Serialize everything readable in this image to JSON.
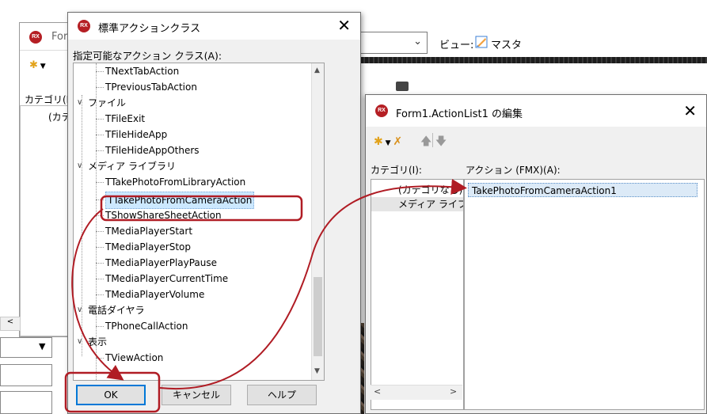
{
  "ide": {
    "view_label": "ビュー:",
    "view_value": "マスタ",
    "back_form_title": "Form",
    "back_category_label": "カテゴリ(I)",
    "back_category_item": "(カテ"
  },
  "std_dialog": {
    "title": "標準アクションクラス",
    "list_label": "指定可能なアクション クラス(A):",
    "tree": [
      {
        "label": "TNextTabAction",
        "level": 2
      },
      {
        "label": "TPreviousTabAction",
        "level": 2
      },
      {
        "label": "ファイル",
        "level": 1
      },
      {
        "label": "TFileExit",
        "level": 2
      },
      {
        "label": "TFileHideApp",
        "level": 2
      },
      {
        "label": "TFileHideAppOthers",
        "level": 2
      },
      {
        "label": "メディア ライブラリ",
        "level": 1
      },
      {
        "label": "TTakePhotoFromLibraryAction",
        "level": 2
      },
      {
        "label": "TTakePhotoFromCameraAction",
        "level": 2,
        "selected": true
      },
      {
        "label": "TShowShareSheetAction",
        "level": 2
      },
      {
        "label": "TMediaPlayerStart",
        "level": 2
      },
      {
        "label": "TMediaPlayerStop",
        "level": 2
      },
      {
        "label": "TMediaPlayerPlayPause",
        "level": 2
      },
      {
        "label": "TMediaPlayerCurrentTime",
        "level": 2
      },
      {
        "label": "TMediaPlayerVolume",
        "level": 2
      },
      {
        "label": "電話ダイヤラ",
        "level": 1
      },
      {
        "label": "TPhoneCallAction",
        "level": 2
      },
      {
        "label": "表示",
        "level": 1
      },
      {
        "label": "TViewAction",
        "level": 2
      }
    ],
    "ok_label": "OK",
    "cancel_label": "キャンセル",
    "help_label": "ヘルプ"
  },
  "action_list": {
    "title": "Form1.ActionList1 の編集",
    "category_label": "カテゴリ(I):",
    "action_label": "アクション (FMX)(A):",
    "categories": [
      {
        "label": "(カテゴリなし)",
        "selected": false
      },
      {
        "label": "メディア ライブラリ",
        "selected": true
      }
    ],
    "actions": [
      "TakePhotoFromCameraAction1"
    ]
  },
  "colors": {
    "annotation": "#b01c24",
    "selection": "#cce8ff",
    "rx_badge": "#b51f24"
  },
  "icons": [
    "rx-logo-icon",
    "close-icon",
    "new-action-icon",
    "dropdown-icon",
    "delete-action-icon",
    "move-up-icon",
    "move-down-icon",
    "master-view-icon",
    "chevron-down-icon",
    "expand-icon",
    "scroll-up-icon",
    "scroll-down-icon",
    "scroll-left-icon",
    "scroll-right-icon",
    "camera-icon"
  ]
}
